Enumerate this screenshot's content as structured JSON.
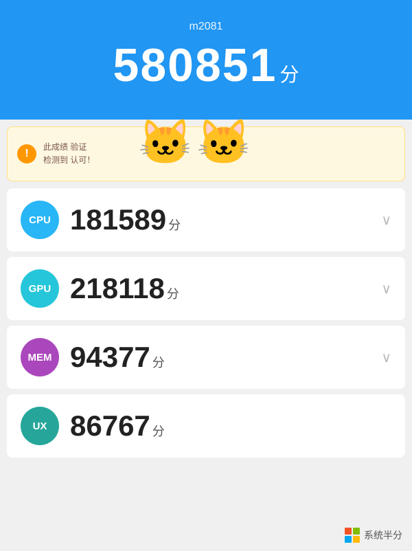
{
  "header": {
    "device_name": "m2081",
    "total_score": "580851",
    "score_unit": "分"
  },
  "warning": {
    "icon": "!",
    "text_line1": "此成绩           验证",
    "text_line2": "检测到        认可！"
  },
  "scores": [
    {
      "id": "cpu",
      "label": "CPU",
      "value": "181589",
      "unit": "分",
      "badge_class": "badge-cpu"
    },
    {
      "id": "gpu",
      "label": "GPU",
      "value": "218118",
      "unit": "分",
      "badge_class": "badge-gpu"
    },
    {
      "id": "mem",
      "label": "MEM",
      "value": "94377",
      "unit": "分",
      "badge_class": "badge-mem"
    },
    {
      "id": "ux",
      "label": "UX",
      "value": "86767",
      "unit": "分",
      "badge_class": "badge-ux"
    }
  ],
  "watermark": {
    "text": "系统半分"
  }
}
